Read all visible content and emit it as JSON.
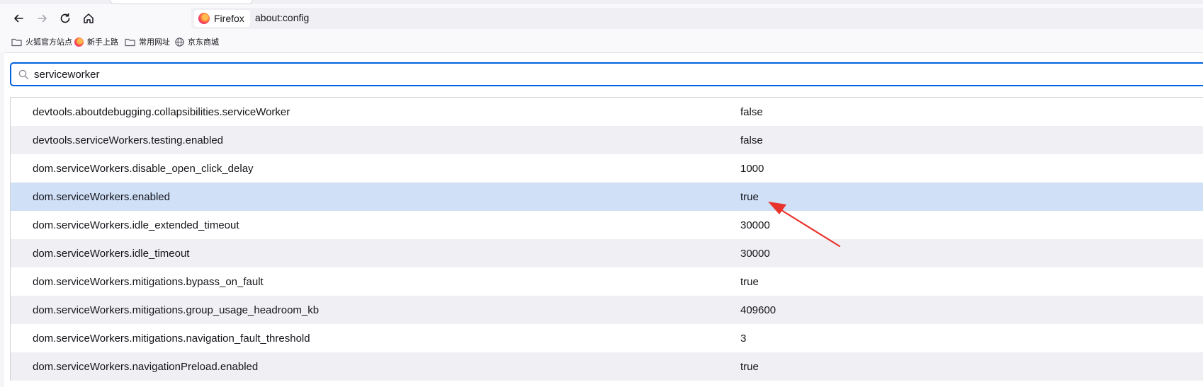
{
  "browser": {
    "identity_label": "Firefox",
    "url": "about:config",
    "icons": [
      "back-icon",
      "forward-icon",
      "reload-icon",
      "home-icon",
      "firefox-logo-icon"
    ]
  },
  "bookmarks": [
    {
      "label": "火狐官方站点",
      "icon": "folder-icon"
    },
    {
      "label": "新手上路",
      "icon": "firefox-logo-icon"
    },
    {
      "label": "常用网址",
      "icon": "folder-icon"
    },
    {
      "label": "京东商城",
      "icon": "globe-icon"
    }
  ],
  "search": {
    "value": "serviceworker",
    "icon": "search-icon"
  },
  "prefs": [
    {
      "name": "devtools.aboutdebugging.collapsibilities.serviceWorker",
      "value": "false"
    },
    {
      "name": "devtools.serviceWorkers.testing.enabled",
      "value": "false"
    },
    {
      "name": "dom.serviceWorkers.disable_open_click_delay",
      "value": "1000"
    },
    {
      "name": "dom.serviceWorkers.enabled",
      "value": "true"
    },
    {
      "name": "dom.serviceWorkers.idle_extended_timeout",
      "value": "30000"
    },
    {
      "name": "dom.serviceWorkers.idle_timeout",
      "value": "30000"
    },
    {
      "name": "dom.serviceWorkers.mitigations.bypass_on_fault",
      "value": "true"
    },
    {
      "name": "dom.serviceWorkers.mitigations.group_usage_headroom_kb",
      "value": "409600"
    },
    {
      "name": "dom.serviceWorkers.mitigations.navigation_fault_threshold",
      "value": "3"
    },
    {
      "name": "dom.serviceWorkers.navigationPreload.enabled",
      "value": "true"
    }
  ],
  "colors": {
    "selected_row": "#cfe0f7",
    "alt_row": "#f0f0f4",
    "search_border": "#0061e0",
    "annotation_arrow": "#e8332c"
  }
}
